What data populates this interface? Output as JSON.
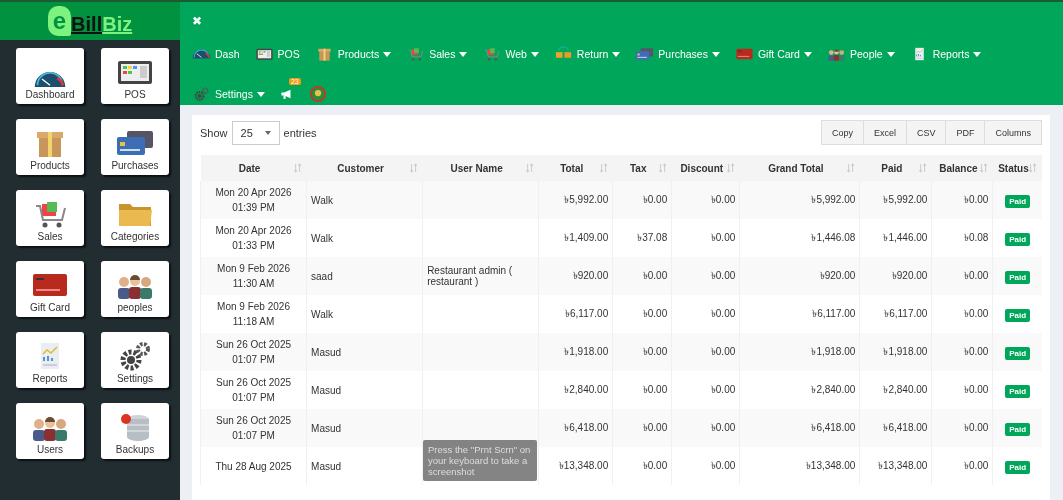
{
  "logo": {
    "badge": "e",
    "first": "Bill",
    "second": "Biz"
  },
  "close": "✖",
  "sidebar_tiles": [
    {
      "label": "Dashboard",
      "kind": "gauge"
    },
    {
      "label": "POS",
      "kind": "terminal"
    },
    {
      "label": "Products",
      "kind": "box"
    },
    {
      "label": "Purchases",
      "kind": "cards"
    },
    {
      "label": "Sales",
      "kind": "cart"
    },
    {
      "label": "Categories",
      "kind": "folder"
    },
    {
      "label": "Gift Card",
      "kind": "giftcard"
    },
    {
      "label": "peoples",
      "kind": "people"
    },
    {
      "label": "Reports",
      "kind": "report"
    },
    {
      "label": "Settings",
      "kind": "gears"
    },
    {
      "label": "Users",
      "kind": "people"
    },
    {
      "label": "Backups",
      "kind": "database"
    }
  ],
  "nav": [
    {
      "label": "Dash",
      "kind": "gauge",
      "dropdown": false
    },
    {
      "label": "POS",
      "kind": "terminal",
      "dropdown": false
    },
    {
      "label": "Products",
      "kind": "box",
      "dropdown": true
    },
    {
      "label": "Sales",
      "kind": "cart",
      "dropdown": true
    },
    {
      "label": "Web",
      "kind": "cart",
      "dropdown": true
    },
    {
      "label": "Return",
      "kind": "return",
      "dropdown": true
    },
    {
      "label": "Purchases",
      "kind": "cards",
      "dropdown": true
    },
    {
      "label": "Gift Card",
      "kind": "giftcard",
      "dropdown": true
    },
    {
      "label": "People",
      "kind": "people",
      "dropdown": true
    },
    {
      "label": "Reports",
      "kind": "report",
      "dropdown": true
    },
    {
      "label": "Settings",
      "kind": "gears",
      "dropdown": true
    }
  ],
  "notifications": {
    "count": "23"
  },
  "length_menu": {
    "label": "Show",
    "value": "25",
    "suffix": "entries"
  },
  "export_buttons": [
    "Copy",
    "Excel",
    "CSV",
    "PDF",
    "Columns"
  ],
  "table": {
    "columns": [
      "Date",
      "Customer",
      "User Name",
      "Total",
      "Tax",
      "Discount",
      "Grand Total",
      "Paid",
      "Balance",
      "Status"
    ],
    "rows": [
      {
        "date": "Mon 20 Apr 2026 01:39 PM",
        "customer": "Walk",
        "total": "৳5,992.00",
        "tax": "৳0.00",
        "discount": "৳0.00",
        "grand_total": "৳5,992.00",
        "paid": "৳5,992.00",
        "balance": "৳0.00",
        "status": "Paid"
      },
      {
        "date": "Mon 20 Apr 2026 01:33 PM",
        "customer": "Walk",
        "total": "৳1,409.00",
        "tax": "৳37.08",
        "discount": "৳0.00",
        "grand_total": "৳1,446.08",
        "paid": "৳1,446.00",
        "balance": "৳0.08",
        "status": "Paid"
      },
      {
        "date": "Mon 9 Feb 2026 11:30 AM",
        "customer": "saad",
        "user_name": "Restaurant admin ( restaurant )",
        "total": "৳920.00",
        "tax": "৳0.00",
        "discount": "৳0.00",
        "grand_total": "৳920.00",
        "paid": "৳920.00",
        "balance": "৳0.00",
        "status": "Paid"
      },
      {
        "date": "Mon 9 Feb 2026 11:18 AM",
        "customer": "Walk",
        "total": "৳6,117.00",
        "tax": "৳0.00",
        "discount": "৳0.00",
        "grand_total": "৳6,117.00",
        "paid": "৳6,117.00",
        "balance": "৳0.00",
        "status": "Paid"
      },
      {
        "date": "Sun 26 Oct 2025 01:07 PM",
        "customer": "Masud",
        "total": "৳1,918.00",
        "tax": "৳0.00",
        "discount": "৳0.00",
        "grand_total": "৳1,918.00",
        "paid": "৳1,918.00",
        "balance": "৳0.00",
        "status": "Paid"
      },
      {
        "date": "Sun 26 Oct 2025 01:07 PM",
        "customer": "Masud",
        "total": "৳2,840.00",
        "tax": "৳0.00",
        "discount": "৳0.00",
        "grand_total": "৳2,840.00",
        "paid": "৳2,840.00",
        "balance": "৳0.00",
        "status": "Paid"
      },
      {
        "date": "Sun 26 Oct 2025 01:07 PM",
        "customer": "Masud",
        "total": "৳6,418.00",
        "tax": "৳0.00",
        "discount": "৳0.00",
        "grand_total": "৳6,418.00",
        "paid": "৳6,418.00",
        "balance": "৳0.00",
        "status": "Paid"
      },
      {
        "date": "Thu 28 Aug 2025",
        "customer": "Masud",
        "total": "৳13,348.00",
        "tax": "৳0.00",
        "discount": "৳0.00",
        "grand_total": "৳13,348.00",
        "paid": "৳13,348.00",
        "balance": "৳0.00",
        "status": "Paid"
      }
    ]
  },
  "toast": "Press the \"Prnt Scrn\" on your keyboard to take a screenshot"
}
